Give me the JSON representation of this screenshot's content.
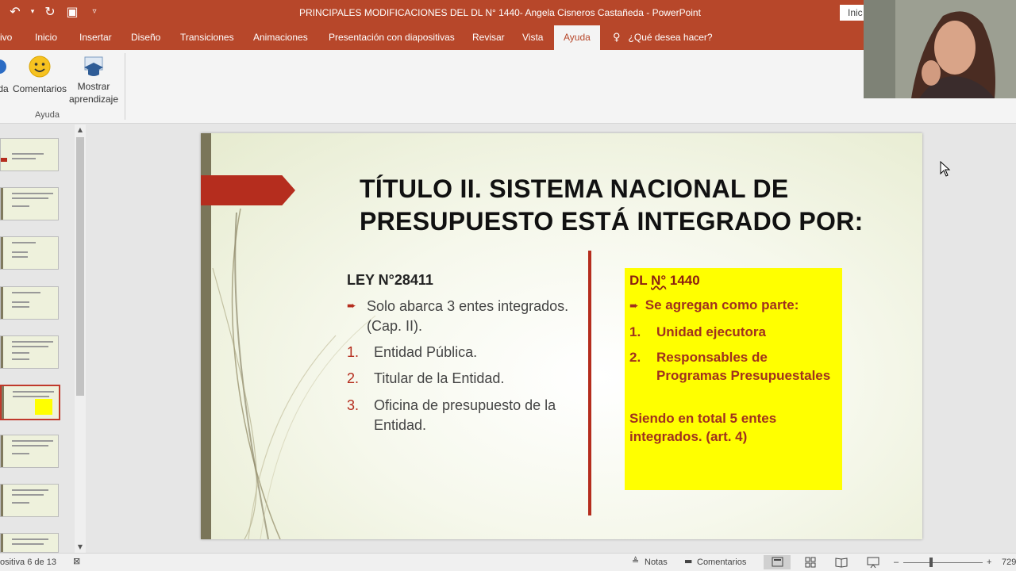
{
  "window": {
    "title": "PRINCIPALES MODIFICACIONES DEL DL N° 1440- Angela Cisneros Castañeda  -  PowerPoint",
    "signin_label": "Inic"
  },
  "tabs": [
    "ivo",
    "Inicio",
    "Insertar",
    "Diseño",
    "Transiciones",
    "Animaciones",
    "Presentación con diapositivas",
    "Revisar",
    "Vista",
    "Ayuda"
  ],
  "active_tab": "Ayuda",
  "tell_me": "¿Qué desea hacer?",
  "ribbon": {
    "partial_label": "da",
    "comments_label": "Comentarios",
    "learning_label_line1": "Mostrar",
    "learning_label_line2": "aprendizaje",
    "group_label": "Ayuda"
  },
  "slide": {
    "title_line1": "TÍTULO II. SISTEMA NACIONAL DE",
    "title_line2": "PRESUPUESTO ESTÁ INTEGRADO POR:",
    "left": {
      "heading": "LEY N°28411",
      "bullet": "Solo abarca 3 entes integrados. (Cap. II).",
      "items": [
        {
          "num": "1.",
          "text": "Entidad Pública."
        },
        {
          "num": "2.",
          "text": "Titular de la Entidad."
        },
        {
          "num": "3.",
          "text": "Oficina de presupuesto de la Entidad."
        }
      ]
    },
    "right": {
      "heading_prefix": "DL ",
      "heading_underlined": "N°",
      "heading_suffix": " 1440",
      "bullet": "Se agregan como parte:",
      "items": [
        {
          "num": "1.",
          "text": "Unidad ejecutora"
        },
        {
          "num": "2.",
          "text": "Responsables de Programas Presupuestales"
        }
      ],
      "total": "Siendo en total 5 entes integrados. (art. 4)"
    }
  },
  "thumbnails": {
    "count_visible": 9,
    "selected_index": 5
  },
  "statusbar": {
    "slide_indicator": "ositiva 6 de 13",
    "notes_label": "Notas",
    "comments_label": "Comentarios",
    "zoom_minus": "–",
    "zoom_plus": "+",
    "zoom_value": "729"
  },
  "colors": {
    "accent": "#b7472a",
    "slide_red": "#b52d1e",
    "highlight_yellow": "#ffff00"
  }
}
